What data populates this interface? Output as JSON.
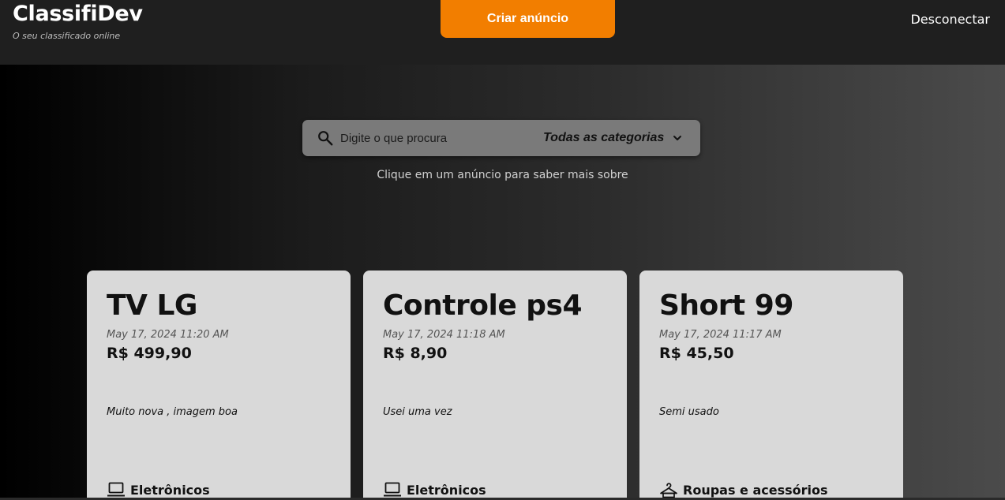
{
  "header": {
    "app_name": "ClassifiDev",
    "tagline": "O seu classificado online",
    "create_button": "Criar anúncio",
    "logout_link": "Desconectar",
    "accent_color": "#f27e00"
  },
  "search": {
    "placeholder": "Digite o que procura",
    "category_selected": "Todas as categorias",
    "icon": "search-icon"
  },
  "hint": "Clique em um anúncio para saber mais sobre",
  "listings": [
    {
      "title": "TV LG",
      "date": "May 17, 2024 11:20 AM",
      "price": "R$ 499,90",
      "description": "Muito nova , imagem boa",
      "category": "Eletrônicos",
      "category_icon": "laptop-icon"
    },
    {
      "title": "Controle ps4",
      "date": "May 17, 2024 11:18 AM",
      "price": "R$ 8,90",
      "description": "Usei uma vez",
      "category": "Eletrônicos",
      "category_icon": "laptop-icon"
    },
    {
      "title": "Short 99",
      "date": "May 17, 2024 11:17 AM",
      "price": "R$ 45,50",
      "description": "Semi usado",
      "category": "Roupas e acessórios",
      "category_icon": "hanger-icon"
    }
  ]
}
